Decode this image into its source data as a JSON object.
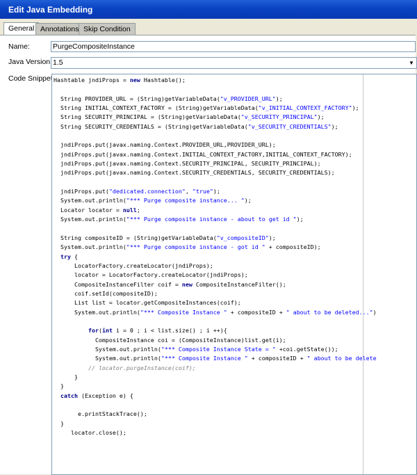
{
  "window": {
    "title": "Edit Java Embedding"
  },
  "tabs": [
    {
      "label": "General",
      "active": true
    },
    {
      "label": "Annotations",
      "active": false
    },
    {
      "label": "Skip Condition",
      "active": false
    }
  ],
  "form": {
    "name_label": "Name:",
    "name_value": "PurgeCompositeInstance",
    "java_version_label": "Java Version:",
    "java_version_value": "1.5",
    "snippet_label": "Code Snippet:"
  },
  "code_lines": [
    [
      {
        "t": "Hashtable jndiProps = "
      },
      {
        "t": "new",
        "c": "k"
      },
      {
        "t": " Hashtable();"
      }
    ],
    [
      {
        "t": ""
      }
    ],
    [
      {
        "t": "  String PROVIDER_URL = (String)getVariableData("
      },
      {
        "t": "\"v_PROVIDER_URL\"",
        "c": "s"
      },
      {
        "t": ");"
      }
    ],
    [
      {
        "t": "  String INITIAL_CONTEXT_FACTORY = (String)getVariableData("
      },
      {
        "t": "\"v_INITIAL_CONTEXT_FACTORY\"",
        "c": "s"
      },
      {
        "t": ");"
      }
    ],
    [
      {
        "t": "  String SECURITY_PRINCIPAL = (String)getVariableData("
      },
      {
        "t": "\"v_SECURITY_PRINCIPAL\"",
        "c": "s"
      },
      {
        "t": ");"
      }
    ],
    [
      {
        "t": "  String SECURITY_CREDENTIALS = (String)getVariableData("
      },
      {
        "t": "\"v_SECURITY_CREDENTIALS\"",
        "c": "s"
      },
      {
        "t": ");"
      }
    ],
    [
      {
        "t": ""
      }
    ],
    [
      {
        "t": "  jndiProps.put(javax.naming.Context.PROVIDER_URL,PROVIDER_URL);"
      }
    ],
    [
      {
        "t": "  jndiProps.put(javax.naming.Context.INITIAL_CONTEXT_FACTORY,INITIAL_CONTEXT_FACTORY);"
      }
    ],
    [
      {
        "t": "  jndiProps.put(javax.naming.Context.SECURITY_PRINCIPAL, SECURITY_PRINCIPAL);"
      }
    ],
    [
      {
        "t": "  jndiProps.put(javax.naming.Context.SECURITY_CREDENTIALS, SECURITY_CREDENTIALS);"
      }
    ],
    [
      {
        "t": ""
      }
    ],
    [
      {
        "t": "  jndiProps.put("
      },
      {
        "t": "\"dedicated.connection\"",
        "c": "s"
      },
      {
        "t": ", "
      },
      {
        "t": "\"true\"",
        "c": "s"
      },
      {
        "t": ");"
      }
    ],
    [
      {
        "t": "  System.out.println("
      },
      {
        "t": "\"*** Purge composite instance... \"",
        "c": "s"
      },
      {
        "t": ");"
      }
    ],
    [
      {
        "t": "  Locator locator = "
      },
      {
        "t": "null",
        "c": "k"
      },
      {
        "t": ";"
      }
    ],
    [
      {
        "t": "  System.out.println("
      },
      {
        "t": "\"*** Purge composite instance - about to get id \"",
        "c": "s"
      },
      {
        "t": ");"
      }
    ],
    [
      {
        "t": ""
      }
    ],
    [
      {
        "t": "  String compositeID = (String)getVariableData("
      },
      {
        "t": "\"v_compositeID\"",
        "c": "s"
      },
      {
        "t": ");"
      }
    ],
    [
      {
        "t": "  System.out.println("
      },
      {
        "t": "\"*** Purge composite instance - got id \"",
        "c": "s"
      },
      {
        "t": " + compositeID);"
      }
    ],
    [
      {
        "t": "  "
      },
      {
        "t": "try",
        "c": "k"
      },
      {
        "t": " {"
      }
    ],
    [
      {
        "t": "      LocatorFactory.createLocator(jndiProps);"
      }
    ],
    [
      {
        "t": "      locator = LocatorFactory.createLocator(jndiProps);"
      }
    ],
    [
      {
        "t": "      CompositeInstanceFilter coif = "
      },
      {
        "t": "new",
        "c": "k"
      },
      {
        "t": " CompositeInstanceFilter();"
      }
    ],
    [
      {
        "t": "      coif.setId(compositeID);"
      }
    ],
    [
      {
        "t": "      List list = locator.getCompositeInstances(coif);"
      }
    ],
    [
      {
        "t": "      System.out.println("
      },
      {
        "t": "\"*** Composite Instance \"",
        "c": "s"
      },
      {
        "t": " + compositeID + "
      },
      {
        "t": "\" about to be deleted...\"",
        "c": "s"
      },
      {
        "t": ")"
      }
    ],
    [
      {
        "t": ""
      }
    ],
    [
      {
        "t": "          "
      },
      {
        "t": "for",
        "c": "k"
      },
      {
        "t": "("
      },
      {
        "t": "int",
        "c": "k"
      },
      {
        "t": " i = 0 ; i < list.size() ; i ++){"
      }
    ],
    [
      {
        "t": "            CompositeInstance coi = (CompositeInstance)list.get(i);"
      }
    ],
    [
      {
        "t": "            System.out.println("
      },
      {
        "t": "\"*** Composite Instance State = \"",
        "c": "s"
      },
      {
        "t": " +coi.getState());"
      }
    ],
    [
      {
        "t": "            System.out.println("
      },
      {
        "t": "\"*** Composite Instance \"",
        "c": "s"
      },
      {
        "t": " + compositeID + "
      },
      {
        "t": "\" about to be delete",
        "c": "s"
      }
    ],
    [
      {
        "t": "          "
      },
      {
        "t": "// locator.purgeInstance(coif);",
        "c": "c"
      }
    ],
    [
      {
        "t": "      }"
      }
    ],
    [
      {
        "t": "  }"
      }
    ],
    [
      {
        "t": "  "
      },
      {
        "t": "catch",
        "c": "k"
      },
      {
        "t": " (Exception e) {"
      }
    ],
    [
      {
        "t": ""
      }
    ],
    [
      {
        "t": "       e.printStackTrace();"
      }
    ],
    [
      {
        "t": "  }"
      }
    ],
    [
      {
        "t": "     locator.close();"
      }
    ]
  ]
}
